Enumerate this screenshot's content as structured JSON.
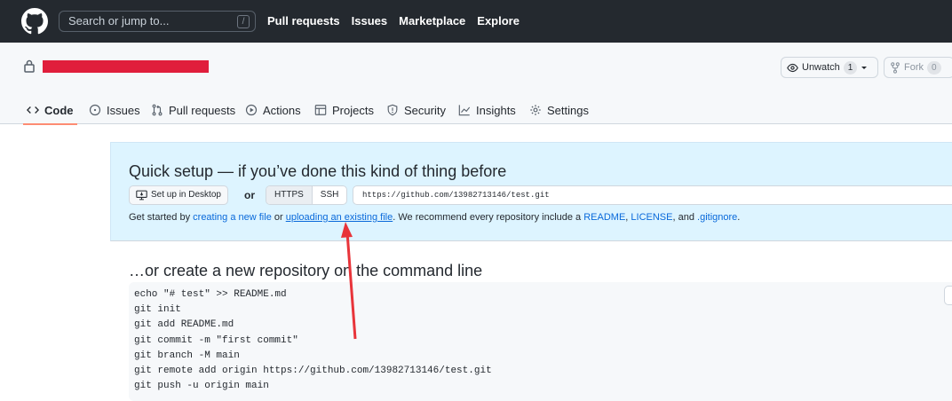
{
  "header": {
    "search_placeholder": "Search or jump to...",
    "search_shortcut": "/",
    "nav": [
      "Pull requests",
      "Issues",
      "Marketplace",
      "Explore"
    ]
  },
  "repo": {
    "unwatch_label": "Unwatch",
    "watch_count": "1",
    "fork_label": "Fork",
    "fork_count": "0",
    "tabs": [
      {
        "label": "Code",
        "icon": "code-icon"
      },
      {
        "label": "Issues",
        "icon": "issue-opened-icon"
      },
      {
        "label": "Pull requests",
        "icon": "git-pull-request-icon"
      },
      {
        "label": "Actions",
        "icon": "play-icon"
      },
      {
        "label": "Projects",
        "icon": "table-icon"
      },
      {
        "label": "Security",
        "icon": "shield-icon"
      },
      {
        "label": "Insights",
        "icon": "graph-icon"
      },
      {
        "label": "Settings",
        "icon": "gear-icon"
      }
    ]
  },
  "setup": {
    "title": "Quick setup — if you’ve done this kind of thing before",
    "desktop_button": "Set up in Desktop",
    "or_label": "or",
    "https_label": "HTTPS",
    "ssh_label": "SSH",
    "clone_url": "https://github.com/13982713146/test.git",
    "help_prefix": "Get started by ",
    "create_link": "creating a new file",
    "or_text": " or ",
    "upload_link": "uploading an existing file",
    "recommend_text": ". We recommend every repository include a ",
    "readme_link": "README",
    "comma": ", ",
    "license_link": "LICENSE",
    "and_text": ", and ",
    "gitignore_link": ".gitignore",
    "period": "."
  },
  "command_line": {
    "title": "…or create a new repository on the command line",
    "lines": [
      "echo \"# test\" >> README.md",
      "git init",
      "git add README.md",
      "git commit -m \"first commit\"",
      "git branch -M main",
      "git remote add origin https://github.com/13982713146/test.git",
      "git push -u origin main"
    ]
  },
  "colors": {
    "header_bg": "#24292f",
    "setup_bg": "#ddf4ff",
    "link": "#0969da",
    "redaction": "#e01e3c",
    "annotation_arrow": "#e8343a",
    "active_tab_underline": "#fd8c73"
  }
}
